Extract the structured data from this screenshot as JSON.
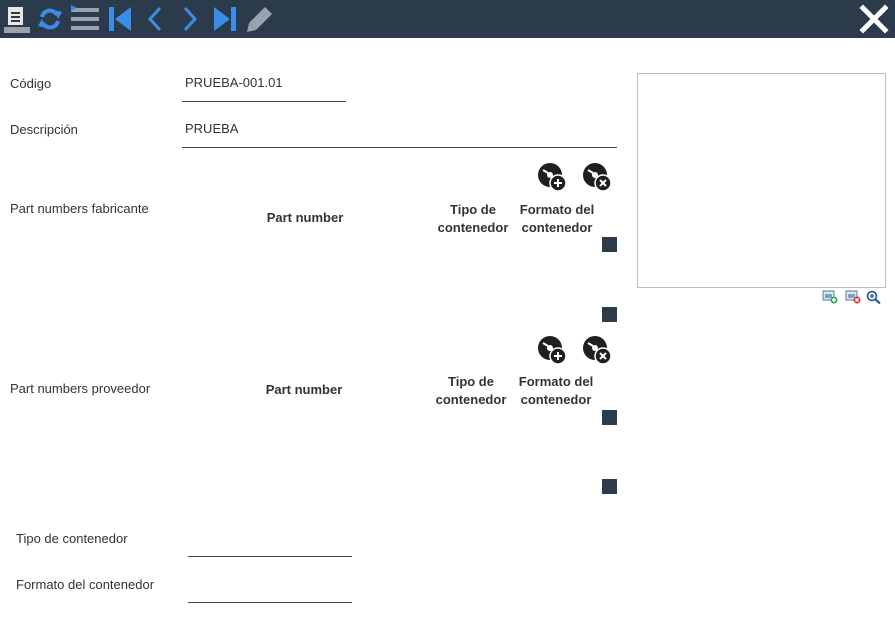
{
  "toolbar": {
    "icons": [
      "document-icon",
      "refresh-icon",
      "list-icon",
      "first-record-icon",
      "previous-icon",
      "next-icon",
      "last-record-icon",
      "edit-pencil-icon",
      "close-icon"
    ],
    "colors": {
      "bar": "#2c3b4b",
      "accent": "#3a8ee6"
    }
  },
  "form": {
    "codigo_label": "Código",
    "codigo_value": "PRUEBA-001.01",
    "descripcion_label": "Descripción",
    "descripcion_value": "PRUEBA",
    "tipo_contenedor_label": "Tipo de contenedor",
    "tipo_contenedor_value": "",
    "formato_contenedor_label": "Formato del contenedor",
    "formato_contenedor_value": ""
  },
  "fabricante": {
    "section_label": "Part numbers fabricante",
    "col_part_number": "Part number",
    "col_tipo_line1": "Tipo de",
    "col_tipo_line2": "contenedor",
    "col_formato_line1": "Formato del",
    "col_formato_line2": "contenedor"
  },
  "proveedor": {
    "section_label": "Part numbers proveedor",
    "col_part_number": "Part number",
    "col_tipo_line1": "Tipo de",
    "col_tipo_line2": "contenedor",
    "col_formato_line1": "Formato del",
    "col_formato_line2": "contenedor"
  },
  "image_panel": {
    "icons": [
      "add-image-icon",
      "remove-image-icon",
      "zoom-image-icon"
    ]
  }
}
